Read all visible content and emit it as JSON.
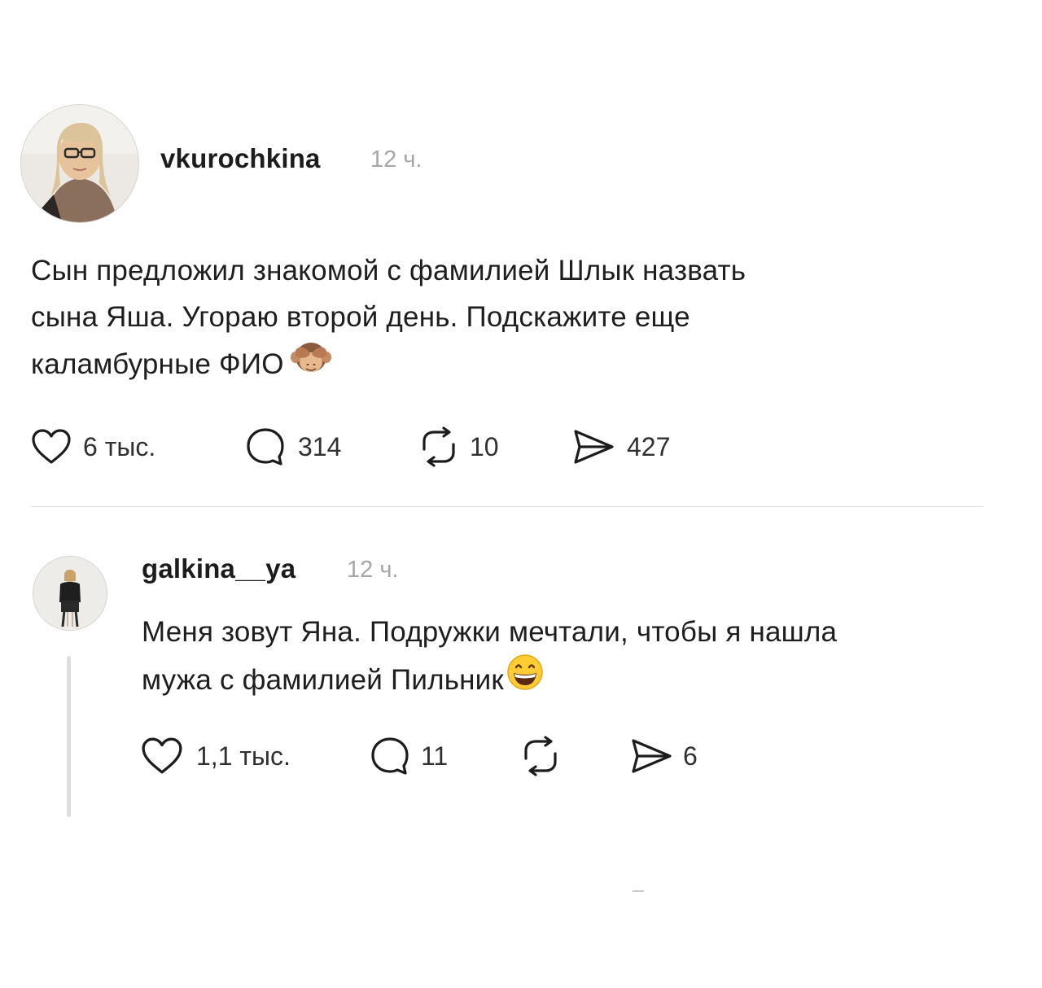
{
  "post": {
    "username": "vkurochkina",
    "time": "12 ч.",
    "text_lines": [
      "Сын предложил знакомой с фамилией Шлык назвать",
      "сына Яша. Угораю второй день. Подскажите еще",
      "каламбурные ФИО"
    ],
    "emoji": "see-no-evil-monkey",
    "stats": {
      "likes": "6 тыс.",
      "comments": "314",
      "reposts": "10",
      "shares": "427"
    }
  },
  "reply": {
    "username": "galkina__ya",
    "time": "12 ч.",
    "text_lines": [
      "Меня зовут Яна. Подружки мечтали, чтобы я нашла",
      "мужа с фамилией Пильник"
    ],
    "emoji": "grinning-face",
    "stats": {
      "likes": "1,1 тыс.",
      "comments": "11",
      "reposts": "",
      "shares": "6"
    }
  },
  "icons": {
    "like": "heart-icon",
    "comment": "speech-bubble-icon",
    "repost": "repost-icon",
    "share": "send-icon"
  }
}
